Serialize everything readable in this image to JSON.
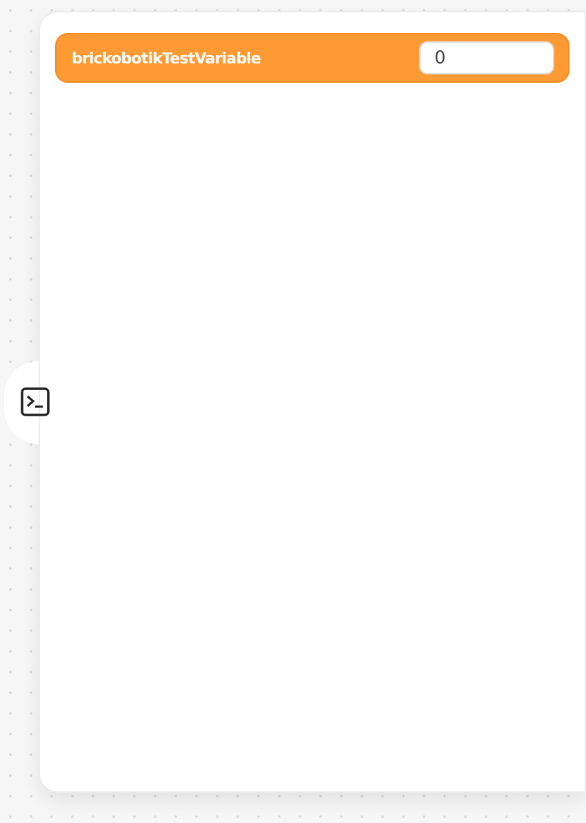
{
  "variables": [
    {
      "name": "brickobotikTestVariable",
      "value": "0"
    }
  ]
}
